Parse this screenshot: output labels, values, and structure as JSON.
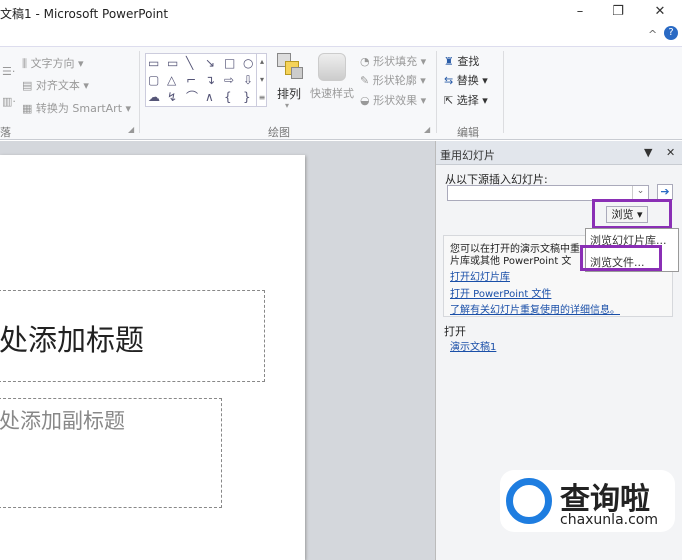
{
  "window": {
    "title": "文稿1 - Microsoft PowerPoint",
    "minimize": "–",
    "restore": "❐",
    "close": "✕",
    "help": "?",
    "collapse": "^"
  },
  "ribbon": {
    "paragraph": {
      "text_direction": "文字方向",
      "align_text": "对齐文本",
      "convert_smartart": "转换为 SmartArt",
      "group_label": "落"
    },
    "drawing": {
      "shapes": [
        "▭",
        "▭",
        "╲",
        "↘",
        "□",
        "○",
        "▢",
        "△",
        "⌐",
        "↴",
        "⇨",
        "⇩",
        "☁",
        "↯",
        "⌒",
        "∧",
        "{",
        "}"
      ],
      "arrange": "排列",
      "quick_styles": "快速样式",
      "shape_fill": "形状填充",
      "shape_outline": "形状轮廓",
      "shape_effects": "形状效果",
      "group_label": "绘图"
    },
    "editing": {
      "find": "查找",
      "replace": "替换",
      "select": "选择",
      "group_label": "编辑"
    }
  },
  "slide": {
    "title_placeholder": "处添加标题",
    "subtitle_placeholder": "处添加副标题"
  },
  "pane": {
    "title": "重用幻灯片",
    "source_label": "从以下源插入幻灯片:",
    "source_value": "",
    "browse": "浏览",
    "info_text": "您可以在打开的演示文稿中或从幻灯片库或其他 PowerPoint 文件中重用幻灯片。",
    "info_line1": "您可以在打开的演示文稿中重",
    "info_line2": "片库或其他 PowerPoint 文",
    "link_open_library": "打开幻灯片库",
    "link_open_file": "打开 PowerPoint 文件",
    "link_learn_more": "了解有关幻灯片重复使用的详细信息。",
    "open_heading": "打开",
    "open_item": "演示文稿1",
    "menu": [
      "浏览幻灯片库...",
      "浏览文件..."
    ]
  },
  "watermark": {
    "brand": "查询啦",
    "url": "chaxunla.com"
  },
  "colors": {
    "highlight": "#8a2fb5",
    "link": "#1a4fa8"
  }
}
